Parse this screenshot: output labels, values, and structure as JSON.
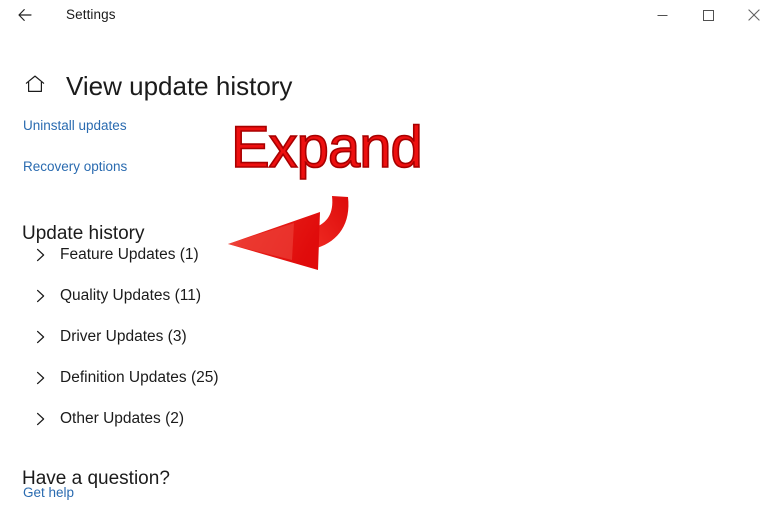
{
  "window": {
    "app_title": "Settings",
    "back_icon": "back-arrow-icon",
    "controls": {
      "minimize": "minimize-icon",
      "maximize": "maximize-icon",
      "close": "close-icon"
    }
  },
  "page": {
    "home_icon": "home-icon",
    "title": "View update history"
  },
  "links": [
    {
      "id": "uninstall",
      "label": "Uninstall updates"
    },
    {
      "id": "recovery",
      "label": "Recovery options"
    }
  ],
  "update_history": {
    "heading": "Update history",
    "items": [
      {
        "label": "Feature Updates (1)",
        "name": "feature-updates",
        "count": 1,
        "expanded": false
      },
      {
        "label": "Quality Updates (11)",
        "name": "quality-updates",
        "count": 11,
        "expanded": false
      },
      {
        "label": "Driver Updates (3)",
        "name": "driver-updates",
        "count": 3,
        "expanded": false
      },
      {
        "label": "Definition Updates (25)",
        "name": "definition-updates",
        "count": 25,
        "expanded": false
      },
      {
        "label": "Other Updates (2)",
        "name": "other-updates",
        "count": 2,
        "expanded": false
      }
    ]
  },
  "footer": {
    "heading": "Have a question?",
    "help_link": "Get help"
  },
  "annotation": {
    "text": "Expand",
    "arrow": "curved-left-arrow-icon",
    "color": "#ee1010",
    "outline_color": "#a80000"
  },
  "colors": {
    "link": "#2a6bb0",
    "text": "#1b1b1b",
    "background": "#ffffff",
    "annotation_red": "#ee1010"
  }
}
